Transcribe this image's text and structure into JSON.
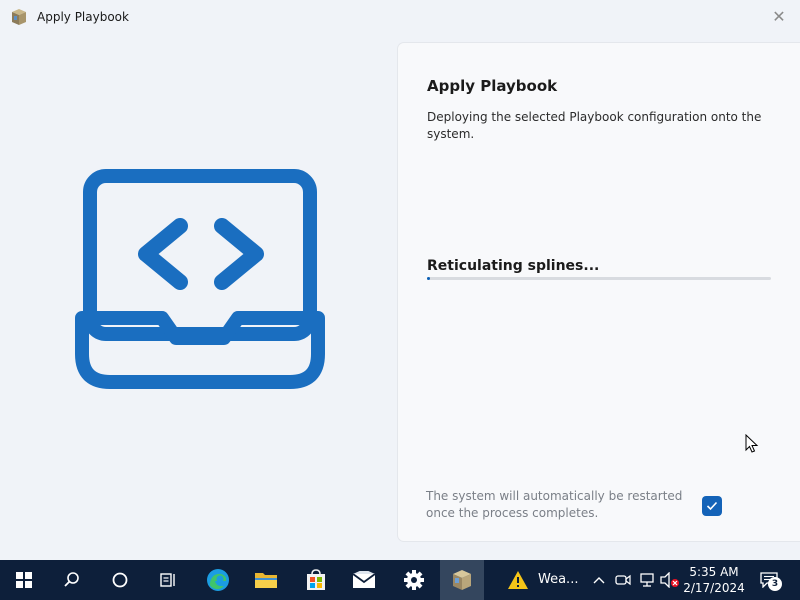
{
  "window": {
    "title": "Apply Playbook",
    "close_symbol": "✕"
  },
  "panel": {
    "heading": "Apply Playbook",
    "description": "Deploying the selected Playbook configuration onto the system.",
    "status": "Reticulating splines...",
    "progress_percent": 1,
    "restart_note": "The system will automatically be restarted once the process completes.",
    "restart_checked": true
  },
  "hero": {
    "icon": "laptop-code-icon",
    "color": "#1a6ec0"
  },
  "taskbar": {
    "icons": [
      "windows-start-icon",
      "search-icon",
      "cortana-icon",
      "task-view-icon",
      "edge-icon",
      "file-explorer-icon",
      "store-icon",
      "mail-icon",
      "settings-icon",
      "playbook-app-icon"
    ],
    "weather_label": "Wea...",
    "clock_time": "5:35 AM",
    "clock_date": "2/17/2024",
    "notification_count": "3"
  },
  "colors": {
    "accent": "#1463b8",
    "progress": "#0a5fb4",
    "taskbar": "#0d1f3a"
  }
}
